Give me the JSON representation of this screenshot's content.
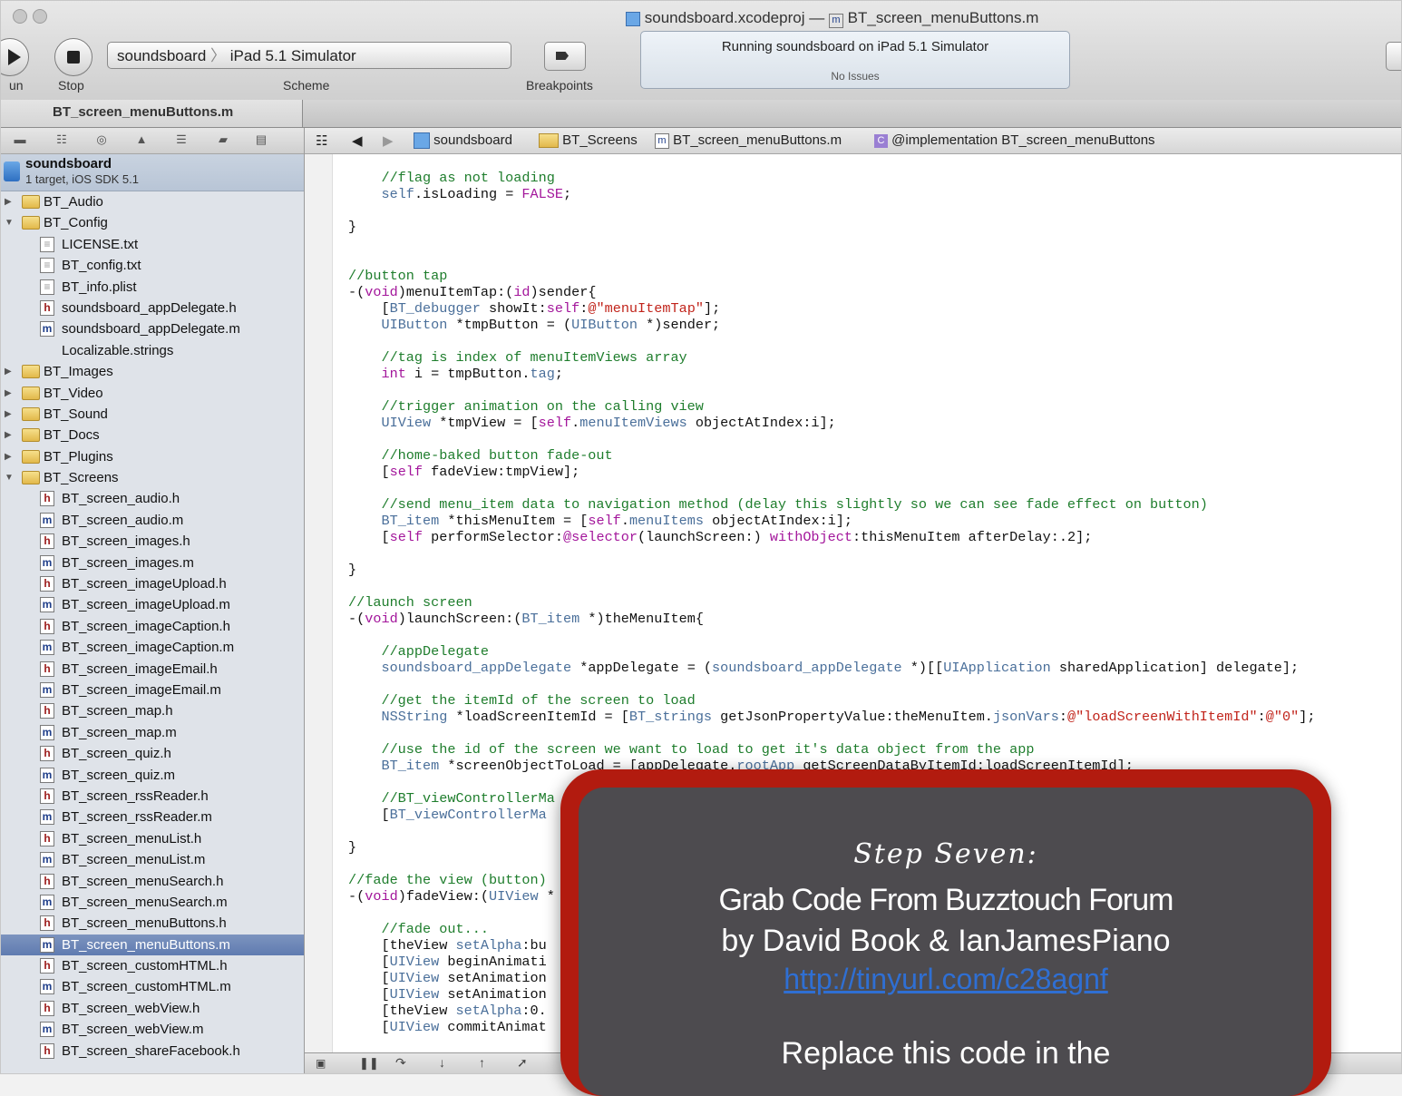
{
  "window": {
    "title": "soundsboard.xcodeproj — BT_screen_menuButtons.m",
    "title_prefix": "soundsboard.xcodeproj",
    "title_file": "BT_screen_menuButtons.m"
  },
  "toolbar": {
    "run_label": "un",
    "stop_label": "Stop",
    "scheme_label": "Scheme",
    "scheme_value": "soundsboard",
    "scheme_destination": "iPad 5.1 Simulator",
    "breakpoints_label": "Breakpoints",
    "activity_status": "Running soundsboard on iPad 5.1 Simulator",
    "activity_issues": "No Issues"
  },
  "tab": {
    "label": "BT_screen_menuButtons.m"
  },
  "jumpbar": {
    "items": [
      "soundsboard",
      "BT_Screens",
      "BT_screen_menuButtons.m",
      "@implementation BT_screen_menuButtons"
    ]
  },
  "navigator": {
    "project": {
      "name": "soundsboard",
      "subtitle": "1 target, iOS SDK 5.1"
    },
    "rows": [
      {
        "label": "BT_Audio",
        "kind": "folder",
        "depth": 0,
        "open": false
      },
      {
        "label": "BT_Config",
        "kind": "folder",
        "depth": 0,
        "open": true
      },
      {
        "label": "LICENSE.txt",
        "kind": "t",
        "depth": 1
      },
      {
        "label": "BT_config.txt",
        "kind": "t",
        "depth": 1
      },
      {
        "label": "BT_info.plist",
        "kind": "t",
        "depth": 1
      },
      {
        "label": "soundsboard_appDelegate.h",
        "kind": "h",
        "depth": 1
      },
      {
        "label": "soundsboard_appDelegate.m",
        "kind": "m",
        "depth": 1
      },
      {
        "label": "Localizable.strings",
        "kind": "none",
        "depth": 1
      },
      {
        "label": "BT_Images",
        "kind": "folder",
        "depth": 0,
        "open": false
      },
      {
        "label": "BT_Video",
        "kind": "folder",
        "depth": 0,
        "open": false
      },
      {
        "label": "BT_Sound",
        "kind": "folder",
        "depth": 0,
        "open": false
      },
      {
        "label": "BT_Docs",
        "kind": "folder",
        "depth": 0,
        "open": false
      },
      {
        "label": "BT_Plugins",
        "kind": "folder",
        "depth": 0,
        "open": false
      },
      {
        "label": "BT_Screens",
        "kind": "folder",
        "depth": 0,
        "open": true
      },
      {
        "label": "BT_screen_audio.h",
        "kind": "h",
        "depth": 1
      },
      {
        "label": "BT_screen_audio.m",
        "kind": "m",
        "depth": 1
      },
      {
        "label": "BT_screen_images.h",
        "kind": "h",
        "depth": 1
      },
      {
        "label": "BT_screen_images.m",
        "kind": "m",
        "depth": 1
      },
      {
        "label": "BT_screen_imageUpload.h",
        "kind": "h",
        "depth": 1
      },
      {
        "label": "BT_screen_imageUpload.m",
        "kind": "m",
        "depth": 1
      },
      {
        "label": "BT_screen_imageCaption.h",
        "kind": "h",
        "depth": 1
      },
      {
        "label": "BT_screen_imageCaption.m",
        "kind": "m",
        "depth": 1
      },
      {
        "label": "BT_screen_imageEmail.h",
        "kind": "h",
        "depth": 1
      },
      {
        "label": "BT_screen_imageEmail.m",
        "kind": "m",
        "depth": 1
      },
      {
        "label": "BT_screen_map.h",
        "kind": "h",
        "depth": 1
      },
      {
        "label": "BT_screen_map.m",
        "kind": "m",
        "depth": 1
      },
      {
        "label": "BT_screen_quiz.h",
        "kind": "h",
        "depth": 1
      },
      {
        "label": "BT_screen_quiz.m",
        "kind": "m",
        "depth": 1
      },
      {
        "label": "BT_screen_rssReader.h",
        "kind": "h",
        "depth": 1
      },
      {
        "label": "BT_screen_rssReader.m",
        "kind": "m",
        "depth": 1
      },
      {
        "label": "BT_screen_menuList.h",
        "kind": "h",
        "depth": 1
      },
      {
        "label": "BT_screen_menuList.m",
        "kind": "m",
        "depth": 1
      },
      {
        "label": "BT_screen_menuSearch.h",
        "kind": "h",
        "depth": 1
      },
      {
        "label": "BT_screen_menuSearch.m",
        "kind": "m",
        "depth": 1
      },
      {
        "label": "BT_screen_menuButtons.h",
        "kind": "h",
        "depth": 1
      },
      {
        "label": "BT_screen_menuButtons.m",
        "kind": "m",
        "depth": 1,
        "selected": true
      },
      {
        "label": "BT_screen_customHTML.h",
        "kind": "h",
        "depth": 1
      },
      {
        "label": "BT_screen_customHTML.m",
        "kind": "m",
        "depth": 1
      },
      {
        "label": "BT_screen_webView.h",
        "kind": "h",
        "depth": 1
      },
      {
        "label": "BT_screen_webView.m",
        "kind": "m",
        "depth": 1
      },
      {
        "label": "BT_screen_shareFacebook.h",
        "kind": "h",
        "depth": 1
      }
    ]
  },
  "code_lines": [
    [
      [
        "cm",
        "    //flag as not loading"
      ]
    ],
    [
      [
        "",
        "    "
      ],
      [
        "ty",
        "self"
      ],
      [
        "",
        ".isLoading = "
      ],
      [
        "kw",
        "FALSE"
      ],
      [
        "",
        ";"
      ]
    ],
    [
      [
        "",
        ""
      ]
    ],
    [
      [
        "",
        "}"
      ]
    ],
    [
      [
        "",
        ""
      ]
    ],
    [
      [
        "",
        ""
      ]
    ],
    [
      [
        "cm",
        "//button tap"
      ]
    ],
    [
      [
        "",
        "-("
      ],
      [
        "kw",
        "void"
      ],
      [
        "",
        ")menuItemTap:("
      ],
      [
        "kw",
        "id"
      ],
      [
        "",
        ")sender{"
      ]
    ],
    [
      [
        "",
        "    ["
      ],
      [
        "ty",
        "BT_debugger"
      ],
      [
        "",
        " showIt:"
      ],
      [
        "kw",
        "self"
      ],
      [
        "",
        ":"
      ],
      [
        "st",
        "@\"menuItemTap\""
      ],
      [
        "",
        "];"
      ]
    ],
    [
      [
        "",
        "    "
      ],
      [
        "ty",
        "UIButton"
      ],
      [
        "",
        " *tmpButton = ("
      ],
      [
        "ty",
        "UIButton"
      ],
      [
        "",
        " *)sender;"
      ]
    ],
    [
      [
        "",
        ""
      ]
    ],
    [
      [
        "cm",
        "    //tag is index of menuItemViews array"
      ]
    ],
    [
      [
        "",
        "    "
      ],
      [
        "kw",
        "int"
      ],
      [
        "",
        " i = tmpButton."
      ],
      [
        "ty",
        "tag"
      ],
      [
        "",
        ";"
      ]
    ],
    [
      [
        "",
        ""
      ]
    ],
    [
      [
        "cm",
        "    //trigger animation on the calling view"
      ]
    ],
    [
      [
        "",
        "    "
      ],
      [
        "ty",
        "UIView"
      ],
      [
        "",
        " *tmpView = ["
      ],
      [
        "kw",
        "self"
      ],
      [
        "",
        "."
      ],
      [
        "ty",
        "menuItemViews"
      ],
      [
        "",
        " objectAtIndex:i];"
      ]
    ],
    [
      [
        "",
        ""
      ]
    ],
    [
      [
        "cm",
        "    //home-baked button fade-out"
      ]
    ],
    [
      [
        "",
        "    ["
      ],
      [
        "kw",
        "self"
      ],
      [
        "",
        " fadeView:tmpView];"
      ]
    ],
    [
      [
        "",
        ""
      ]
    ],
    [
      [
        "cm",
        "    //send menu_item data to navigation method (delay this slightly so we can see fade effect on button)"
      ]
    ],
    [
      [
        "",
        "    "
      ],
      [
        "ty",
        "BT_item"
      ],
      [
        "",
        " *thisMenuItem = ["
      ],
      [
        "kw",
        "self"
      ],
      [
        "",
        "."
      ],
      [
        "ty",
        "menuItems"
      ],
      [
        "",
        " objectAtIndex:i];"
      ]
    ],
    [
      [
        "",
        "    ["
      ],
      [
        "kw",
        "self"
      ],
      [
        "",
        " performSelector:"
      ],
      [
        "kw",
        "@selector"
      ],
      [
        "",
        "(launchScreen:) "
      ],
      [
        "kw",
        "withObject"
      ],
      [
        "",
        ":thisMenuItem afterDelay:.2];"
      ]
    ],
    [
      [
        "",
        ""
      ]
    ],
    [
      [
        "",
        "}"
      ]
    ],
    [
      [
        "",
        ""
      ]
    ],
    [
      [
        "cm",
        "//launch screen"
      ]
    ],
    [
      [
        "",
        "-("
      ],
      [
        "kw",
        "void"
      ],
      [
        "",
        ")launchScreen:("
      ],
      [
        "ty",
        "BT_item"
      ],
      [
        "",
        " *)theMenuItem{"
      ]
    ],
    [
      [
        "",
        ""
      ]
    ],
    [
      [
        "cm",
        "    //appDelegate"
      ]
    ],
    [
      [
        "",
        "    "
      ],
      [
        "ty",
        "soundsboard_appDelegate"
      ],
      [
        "",
        " *appDelegate = ("
      ],
      [
        "ty",
        "soundsboard_appDelegate"
      ],
      [
        "",
        " *)[["
      ],
      [
        "ty",
        "UIApplication"
      ],
      [
        "",
        " sharedApplication] delegate];"
      ]
    ],
    [
      [
        "",
        ""
      ]
    ],
    [
      [
        "cm",
        "    //get the itemId of the screen to load"
      ]
    ],
    [
      [
        "",
        "    "
      ],
      [
        "ty",
        "NSString"
      ],
      [
        "",
        " *loadScreenItemId = ["
      ],
      [
        "ty",
        "BT_strings"
      ],
      [
        "",
        " getJsonPropertyValue:theMenuItem."
      ],
      [
        "ty",
        "jsonVars"
      ],
      [
        "",
        ":"
      ],
      [
        "st",
        "@\"loadScreenWithItemId\""
      ],
      [
        "",
        ":"
      ],
      [
        "st",
        "@\"0\""
      ],
      [
        "",
        "];"
      ]
    ],
    [
      [
        "",
        ""
      ]
    ],
    [
      [
        "cm",
        "    //use the id of the screen we want to load to get it's data object from the app"
      ]
    ],
    [
      [
        "",
        "    "
      ],
      [
        "ty",
        "BT_item"
      ],
      [
        "",
        " *screenObjectToLoad = [appDelegate."
      ],
      [
        "ty",
        "rootApp"
      ],
      [
        "",
        " getScreenDataByItemId:loadScreenItemId];"
      ]
    ],
    [
      [
        "",
        ""
      ]
    ],
    [
      [
        "cm",
        "    //BT_viewControllerMa"
      ]
    ],
    [
      [
        "",
        "    ["
      ],
      [
        "ty",
        "BT_viewControllerMa"
      ]
    ],
    [
      [
        "",
        ""
      ]
    ],
    [
      [
        "",
        "}"
      ]
    ],
    [
      [
        "",
        ""
      ]
    ],
    [
      [
        "cm",
        "//fade the view (button)"
      ]
    ],
    [
      [
        "",
        "-("
      ],
      [
        "kw",
        "void"
      ],
      [
        "",
        ")fadeView:("
      ],
      [
        "ty",
        "UIView"
      ],
      [
        "",
        " *"
      ]
    ],
    [
      [
        "",
        ""
      ]
    ],
    [
      [
        "cm",
        "    //fade out..."
      ]
    ],
    [
      [
        "",
        "    [theView "
      ],
      [
        "ty",
        "setAlpha"
      ],
      [
        "",
        ":bu"
      ]
    ],
    [
      [
        "",
        "    ["
      ],
      [
        "ty",
        "UIView"
      ],
      [
        "",
        " beginAnimati"
      ]
    ],
    [
      [
        "",
        "    ["
      ],
      [
        "ty",
        "UIView"
      ],
      [
        "",
        " setAnimation"
      ]
    ],
    [
      [
        "",
        "    ["
      ],
      [
        "ty",
        "UIView"
      ],
      [
        "",
        " setAnimation"
      ]
    ],
    [
      [
        "",
        "    [theView "
      ],
      [
        "ty",
        "setAlpha"
      ],
      [
        "",
        ":0."
      ]
    ],
    [
      [
        "",
        "    ["
      ],
      [
        "ty",
        "UIView"
      ],
      [
        "",
        " commitAnimat"
      ]
    ]
  ],
  "callout": {
    "step": "Step Seven:",
    "line1": "Grab Code From Buzztouch Forum",
    "line2": "by David Book &  IanJamesPiano",
    "link": "http://tinyurl.com/c28agnf",
    "line4": "Replace this code in the"
  }
}
